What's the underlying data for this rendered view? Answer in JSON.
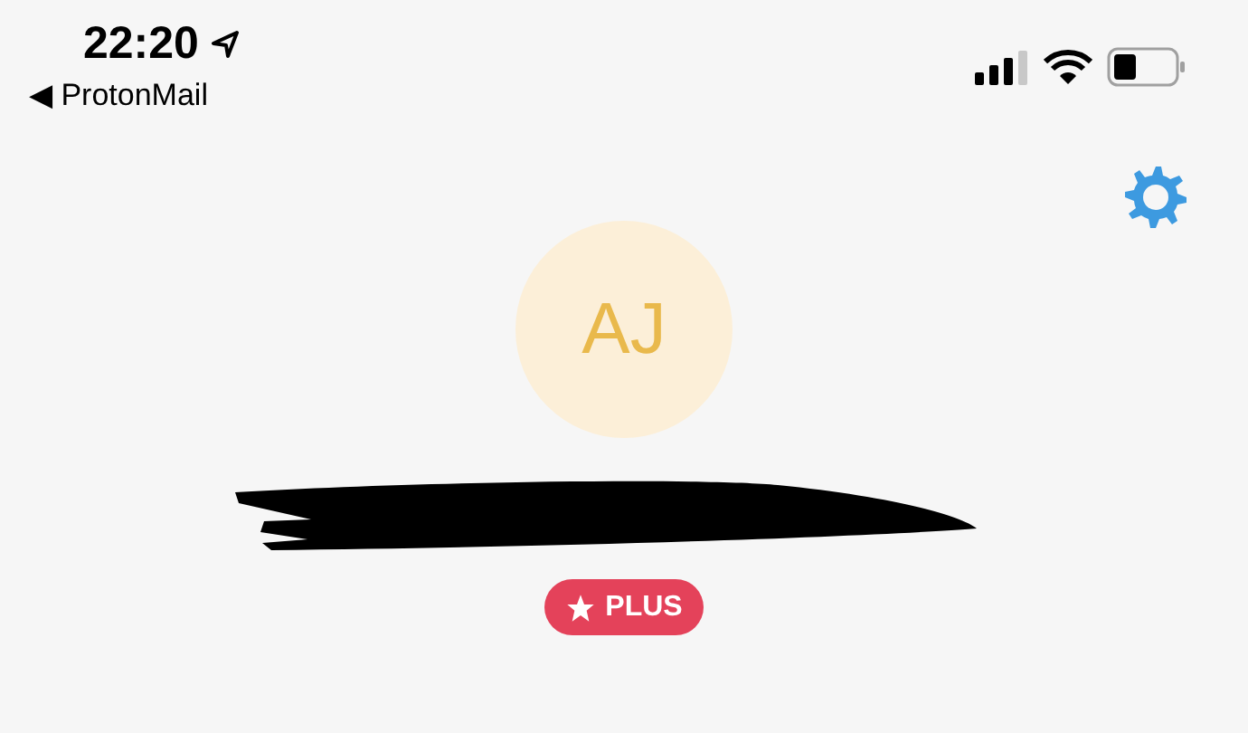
{
  "status_bar": {
    "time": "22:20",
    "back_label": "◀ ProtonMail"
  },
  "profile": {
    "initials": "AJ",
    "badge": "PLUS"
  }
}
